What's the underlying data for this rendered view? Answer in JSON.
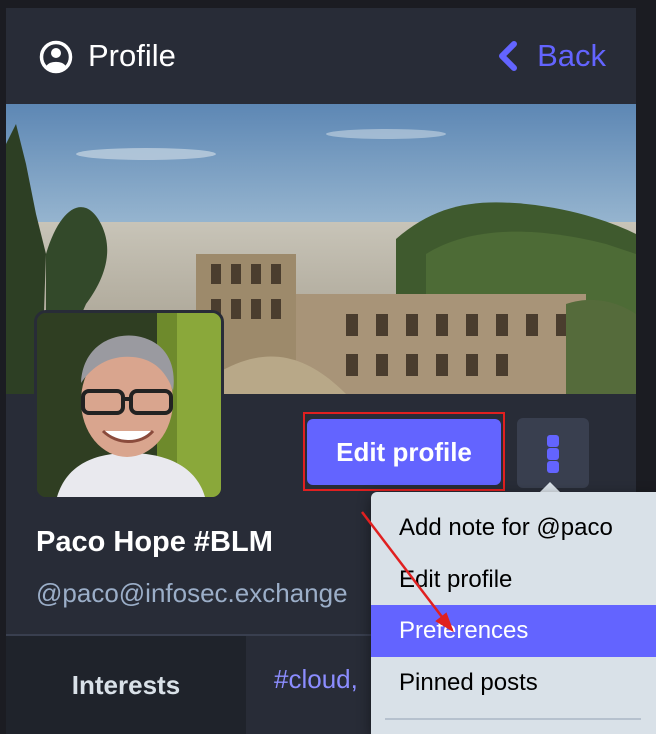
{
  "header": {
    "title": "Profile",
    "back_label": "Back",
    "icons": [
      "user-circle-icon",
      "chevron-left-icon"
    ]
  },
  "profile": {
    "display_name": "Paco Hope #BLM",
    "handle": "@paco@infosec.exchange"
  },
  "actions": {
    "edit_profile_label": "Edit profile",
    "more_icon": "more-vertical-icon"
  },
  "tabs": {
    "interests_label": "Interests",
    "hashtag_label": "#cloud,"
  },
  "menu": {
    "items": [
      {
        "label": "Add note for @paco"
      },
      {
        "label": "Edit profile"
      },
      {
        "label": "Preferences",
        "highlighted": true
      },
      {
        "label": "Pinned posts"
      }
    ]
  },
  "colors": {
    "accent": "#6364ff",
    "panel": "#282c37",
    "menu_bg": "#d9e1e8",
    "annotation_red": "#e02020"
  }
}
